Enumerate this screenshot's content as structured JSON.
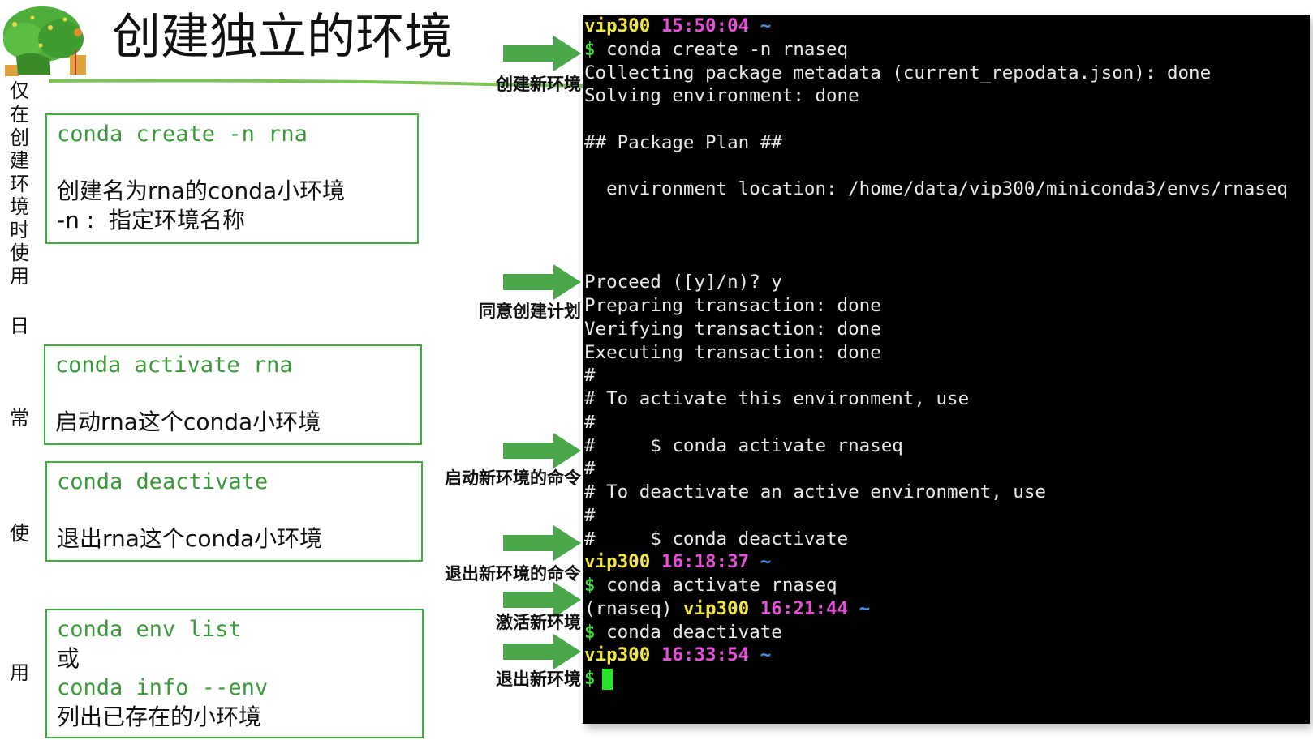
{
  "title": "创建独立的环境",
  "side_text": [
    "仅",
    "在",
    "创",
    "建",
    "环",
    "境",
    "时",
    "使",
    "用",
    "日",
    "常",
    "使",
    "用"
  ],
  "boxes": [
    {
      "cmd": "conda create -n rna",
      "desc": [
        "创建名为rna的conda小环境",
        "-n :  指定环境名称"
      ]
    },
    {
      "cmd": "conda activate rna",
      "desc": [
        "启动rna这个conda小环境"
      ]
    },
    {
      "cmd": "conda deactivate",
      "desc": [
        "退出rna这个conda小环境"
      ]
    },
    {
      "cmd1": "conda env list",
      "or": "或",
      "cmd2": "conda info --env",
      "desc": "列出已存在的小环境"
    }
  ],
  "arrows": [
    {
      "label": "创建新环境"
    },
    {
      "label": "同意创建计划"
    },
    {
      "label": "启动新环境的命令"
    },
    {
      "label": "退出新环境的命令"
    },
    {
      "label": "激活新环境"
    },
    {
      "label": "退出新环境"
    }
  ],
  "terminal": {
    "lines": [
      {
        "user": "vip300",
        "time": "15:50:04",
        "tilde": "~"
      },
      {
        "dollar": "$",
        "text": " conda create -n rnaseq"
      },
      {
        "text": "Collecting package metadata (current_repodata.json): done"
      },
      {
        "text": "Solving environment: done"
      },
      {
        "text": ""
      },
      {
        "text": "## Package Plan ##"
      },
      {
        "text": ""
      },
      {
        "text": "  environment location: /home/data/vip300/miniconda3/envs/rnaseq"
      },
      {
        "text": ""
      },
      {
        "text": ""
      },
      {
        "text": ""
      },
      {
        "text": "Proceed ([y]/n)? y"
      },
      {
        "text": "Preparing transaction: done"
      },
      {
        "text": "Verifying transaction: done"
      },
      {
        "text": "Executing transaction: done"
      },
      {
        "text": "#"
      },
      {
        "text": "# To activate this environment, use"
      },
      {
        "text": "#"
      },
      {
        "text": "#     $ conda activate rnaseq"
      },
      {
        "text": "#"
      },
      {
        "text": "# To deactivate an active environment, use"
      },
      {
        "text": "#"
      },
      {
        "text": "#     $ conda deactivate"
      },
      {
        "user": "vip300",
        "time": "16:18:37",
        "tilde": "~"
      },
      {
        "dollar": "$",
        "text": " conda activate rnaseq"
      },
      {
        "prefix": "(rnaseq) ",
        "user": "vip300",
        "time": "16:21:44",
        "tilde": "~"
      },
      {
        "dollar": "$",
        "text": " conda deactivate"
      },
      {
        "user": "vip300",
        "time": "16:33:54",
        "tilde": "~"
      },
      {
        "dollar": "$",
        "text": "",
        "cursor": true
      }
    ]
  },
  "colors": {
    "terminal_bg": "#000000",
    "user": "#f2e641",
    "time": "#e64fd7",
    "dollar": "#44d444",
    "command_green": "#3a9a3a",
    "box_border": "#3fae3f",
    "arrow_green": "#4aa84a"
  },
  "icons": {
    "logo": "tree-island-logo",
    "arrow": "right-arrow-icon",
    "cursor": "terminal-cursor"
  }
}
